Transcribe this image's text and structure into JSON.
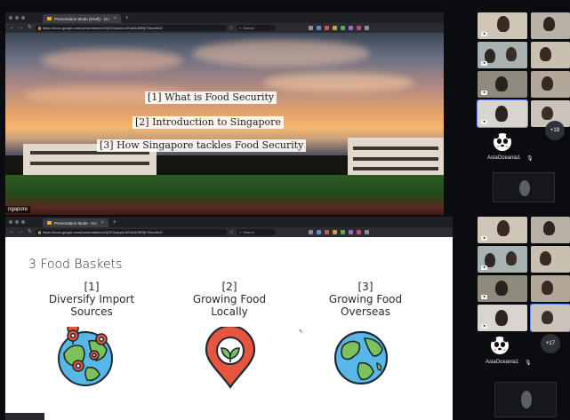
{
  "top_browser": {
    "tab_title": "Presentation Mode (Draft) - Go",
    "url": "https://docs.google.com/presentation/d/1jDK3saxyk-WSdA5JBPjb7SacdKd2",
    "search_label": "Search",
    "corner_label": "ngapore"
  },
  "top_slide": {
    "agenda": [
      "[1] What is Food Security",
      "[2] Introduction to Singapore",
      "[3] How Singapore tackles Food Security"
    ]
  },
  "bottom_browser": {
    "tab_title": "Presentation Mode - Go",
    "url": "https://docs.google.com/presentation/d/1jDK3saxyk-WSdA5JBPjb7SacdKd2",
    "search_label": "Search"
  },
  "bottom_slide": {
    "title": "3 Food Baskets",
    "baskets": [
      {
        "number": "[1]",
        "line1": "Diversify Import",
        "line2": "Sources",
        "icon": "globe-pins-icon"
      },
      {
        "number": "[2]",
        "line1": "Growing Food",
        "line2": "Locally",
        "icon": "map-pin-leaf-icon"
      },
      {
        "number": "[3]",
        "line1": "Growing Food",
        "line2": "Overseas",
        "icon": "globe-icon"
      }
    ]
  },
  "gallery_top": {
    "more_count": "+18",
    "panda_name": "AsiaOceania1"
  },
  "gallery_bottom": {
    "more_count": "+17",
    "panda_name": "AsiaOceania1"
  },
  "colors": {
    "map_pin_red": "#e8553f",
    "globe_blue": "#58b7e6",
    "globe_green": "#7cc25a",
    "active_tile_outline": "#6f8cff"
  }
}
